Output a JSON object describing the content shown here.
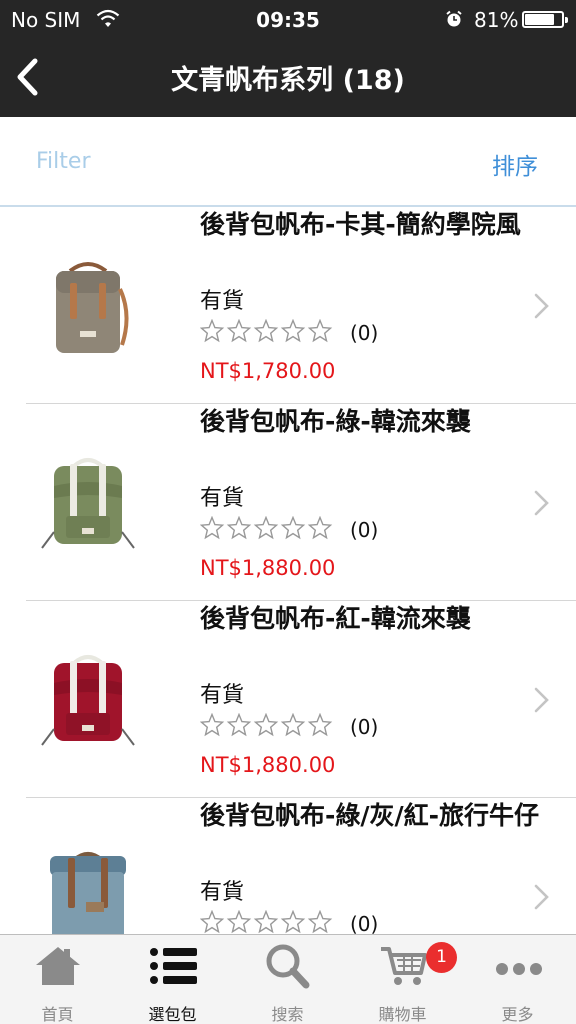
{
  "status_bar": {
    "carrier": "No SIM",
    "time": "09:35",
    "battery": "81%",
    "battery_level": 0.81
  },
  "nav": {
    "title": "文青帆布系列 (18)"
  },
  "filter_bar": {
    "filter_label": "Filter",
    "sort_label": "排序"
  },
  "products": [
    {
      "name": "後背包帆布-卡其-簡約學院風",
      "stock": "有貨",
      "rating": 0,
      "reviews": "(0)",
      "price": "NT$1,780.00"
    },
    {
      "name": "後背包帆布-綠-韓流來襲",
      "stock": "有貨",
      "rating": 0,
      "reviews": "(0)",
      "price": "NT$1,880.00"
    },
    {
      "name": "後背包帆布-紅-韓流來襲",
      "stock": "有貨",
      "rating": 0,
      "reviews": "(0)",
      "price": "NT$1,880.00"
    },
    {
      "name": "後背包帆布-綠/灰/紅-旅行牛仔",
      "stock": "有貨",
      "rating": 0,
      "reviews": "(0)",
      "price": ""
    }
  ],
  "tab_bar": {
    "tabs": [
      {
        "label": "首頁",
        "icon": "home-icon",
        "active": false
      },
      {
        "label": "選包包",
        "icon": "list-icon",
        "active": true
      },
      {
        "label": "搜索",
        "icon": "search-icon",
        "active": false
      },
      {
        "label": "購物車",
        "icon": "cart-icon",
        "active": false
      },
      {
        "label": "更多",
        "icon": "more-icon",
        "active": false
      }
    ],
    "cart_badge": "1"
  },
  "colors": {
    "nav_bg": "#262626",
    "price": "#e4161a",
    "sort_link": "#3f8fd8",
    "filter_link": "#a9cde8",
    "badge": "#ea2e2e"
  }
}
